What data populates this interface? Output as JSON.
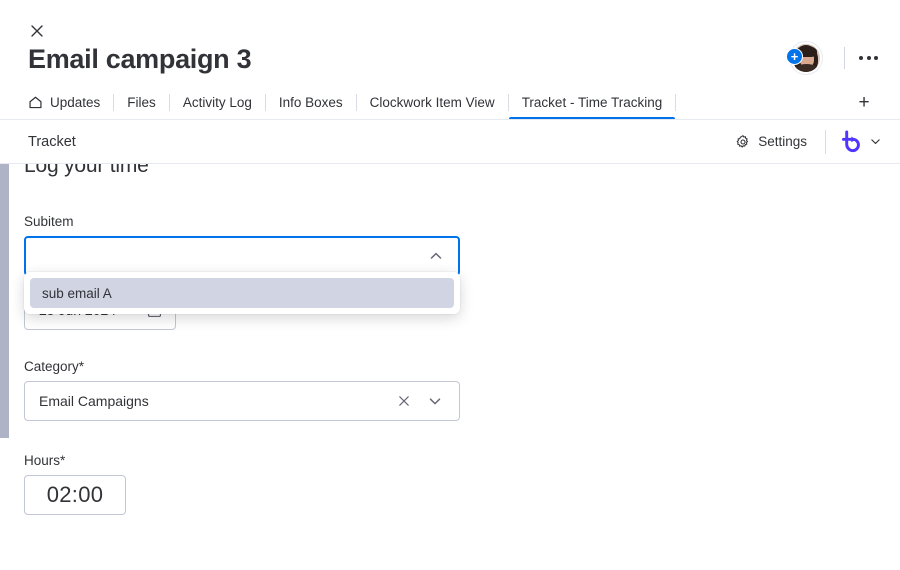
{
  "window": {
    "close_icon": "close-icon",
    "title": "Email campaign 3",
    "kebab_icon": "more-options-icon",
    "add_person_badge": "+",
    "avatar_icon": "user-avatar"
  },
  "tabs": {
    "items": [
      {
        "label": "Updates",
        "icon": "home-icon",
        "active": false
      },
      {
        "label": "Files",
        "icon": "",
        "active": false
      },
      {
        "label": "Activity Log",
        "icon": "",
        "active": false
      },
      {
        "label": "Info Boxes",
        "icon": "",
        "active": false
      },
      {
        "label": "Clockwork Item View",
        "icon": "",
        "active": false
      },
      {
        "label": "Tracket - Time Tracking",
        "icon": "",
        "active": true
      }
    ],
    "add_tab_label": "+",
    "active_underline_color": "#0073ea"
  },
  "app_bar": {
    "name": "Tracket",
    "settings_label": "Settings",
    "settings_icon": "gear-icon",
    "logo_icon": "tracket-logo-icon",
    "logo_color": "#5034ff",
    "chevron_icon": "chevron-down-icon"
  },
  "form": {
    "heading": "Log your time",
    "subitem": {
      "label": "Subitem",
      "value": "",
      "placeholder": "",
      "chevron_icon": "chevron-up-icon",
      "focus_color": "#0073ea",
      "dropdown": {
        "options": [
          {
            "label": "sub email A",
            "highlighted": true
          }
        ]
      }
    },
    "date": {
      "value": "25 Jun 2024",
      "icon": "calendar-icon"
    },
    "category": {
      "label": "Category*",
      "value": "Email Campaigns",
      "clear_icon": "close-icon",
      "chevron_icon": "chevron-down-icon"
    },
    "hours": {
      "label": "Hours*",
      "value": "02:00"
    }
  },
  "scrollbar": {
    "orientation": "vertical",
    "position": "left"
  }
}
